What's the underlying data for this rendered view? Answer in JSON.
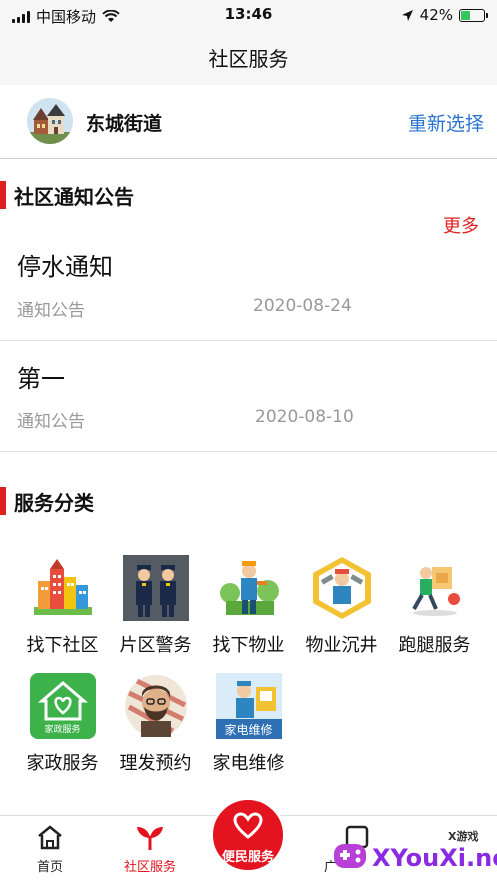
{
  "status": {
    "carrier": "中国移动",
    "time": "13:46",
    "battery": "42%",
    "battery_level": 0.42
  },
  "nav": {
    "title": "社区服务"
  },
  "location": {
    "name": "东城街道",
    "reselect": "重新选择"
  },
  "notices_section": {
    "title": "社区通知公告",
    "more": "更多"
  },
  "notices": [
    {
      "title": "停水通知",
      "tag": "通知公告",
      "date": "2020-08-24"
    },
    {
      "title": "第一",
      "tag": "通知公告",
      "date": "2020-08-10"
    }
  ],
  "services_section": {
    "title": "服务分类"
  },
  "services": [
    {
      "label": "找下社区",
      "icon": "community-buildings-icon"
    },
    {
      "label": "片区警务",
      "icon": "police-officers-icon"
    },
    {
      "label": "找下物业",
      "icon": "property-worker-icon"
    },
    {
      "label": "物业沉井",
      "icon": "repair-worker-icon"
    },
    {
      "label": "跑腿服务",
      "icon": "delivery-runner-icon"
    },
    {
      "label": "家政服务",
      "icon": "housekeeping-house-icon",
      "icon_text": "家政服务"
    },
    {
      "label": "理发预约",
      "icon": "barber-icon"
    },
    {
      "label": "家电维修",
      "icon": "appliance-repair-icon",
      "icon_text": "家电维修"
    }
  ],
  "tabs": [
    {
      "label": "首页",
      "icon": "home-icon"
    },
    {
      "label": "社区服务",
      "icon": "sprout-icon",
      "active": true
    },
    {
      "label": "便民服务",
      "icon": "heart-icon"
    },
    {
      "label": "广",
      "icon": "square-icon"
    }
  ],
  "watermark": {
    "brand": "XYouXi.net",
    "tag": "X游戏"
  },
  "colors": {
    "accent": "#e02020",
    "link": "#2a74d1",
    "tab_active": "#e3131f"
  }
}
